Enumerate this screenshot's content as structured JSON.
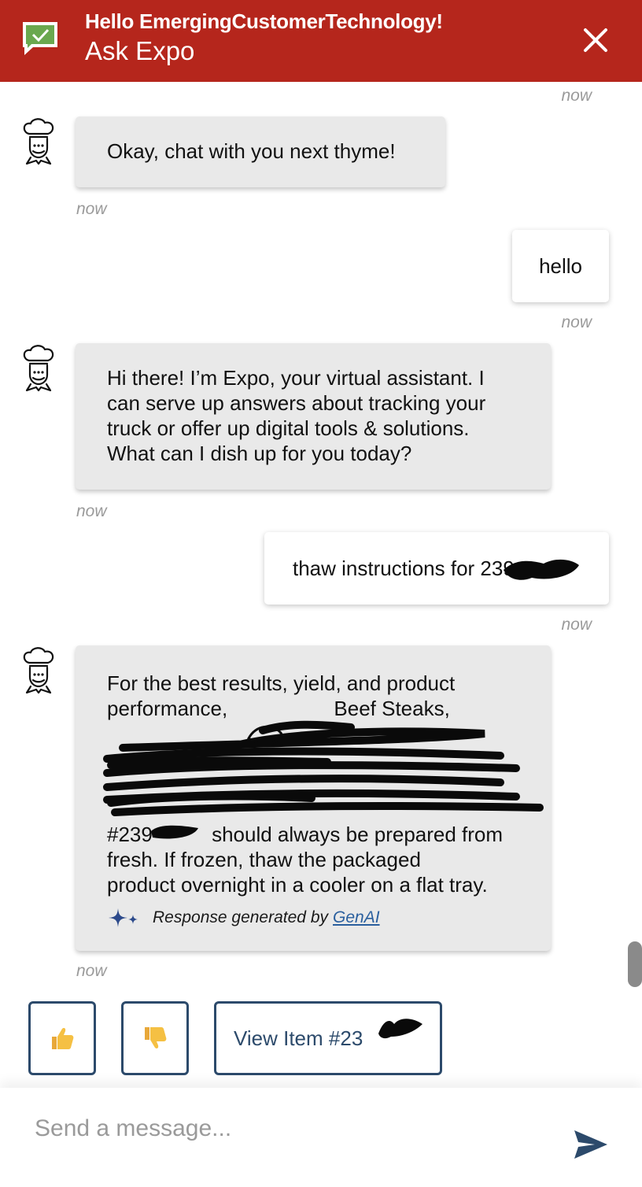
{
  "header": {
    "greeting": "Hello EmergingCustomerTechnology!",
    "title": "Ask Expo",
    "bg_color": "#b5261c",
    "logo_icon": "chat-check-icon",
    "close_icon": "close-icon"
  },
  "messages": [
    {
      "sender": "bot",
      "text": "Okay, chat with you next thyme!",
      "time": "now"
    },
    {
      "sender": "user",
      "text": "hello",
      "time": "now"
    },
    {
      "sender": "bot",
      "lines": [
        "Hi there! I’m Expo, your virtual assistant. I",
        "can serve up answers about tracking your",
        "truck or offer up digital tools & solutions.",
        "What can I dish up for you today?"
      ],
      "time": "now"
    },
    {
      "sender": "user",
      "text": "thaw instructions for 239",
      "time": "now"
    },
    {
      "sender": "bot",
      "lines": [
        "For the best results, yield, and product",
        "performance, ",
        "Beef Steaks,",
        "#239",
        " should always be prepared from",
        "fresh. If frozen, thaw the packaged",
        "product overnight in a cooler on a flat tray."
      ],
      "genai_prefix": "Response generated by",
      "genai_link": "GenAI",
      "time": "now"
    }
  ],
  "top_time": "now",
  "actions": {
    "thumbs_up_icon": "thumbs-up-icon",
    "thumbs_down_icon": "thumbs-down-icon",
    "view_item_label": "View Item #23"
  },
  "input": {
    "placeholder": "Send a message..."
  },
  "colors": {
    "accent": "#2c4a6b",
    "link": "#2a5f9e",
    "bot_bubble": "#e9e9e9"
  }
}
